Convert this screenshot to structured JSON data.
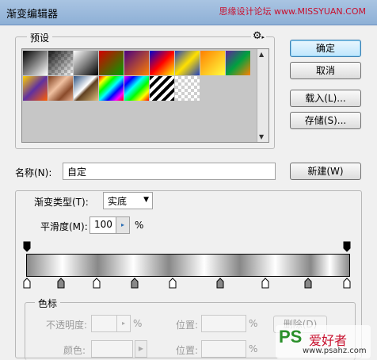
{
  "window": {
    "title": "渐变编辑器",
    "watermark": "思缘设计论坛 www.MISSYUAN.COM"
  },
  "buttons": {
    "ok": "确定",
    "cancel": "取消",
    "load": "载入(L)...",
    "save": "存储(S)...",
    "new": "新建(W)",
    "delete": "删除(D)"
  },
  "presets": {
    "legend": "预设",
    "swatches": [
      {
        "id": "black-white"
      },
      {
        "id": "transparent-fg"
      },
      {
        "id": "black-white-2"
      },
      {
        "id": "red-green"
      },
      {
        "id": "violet-orange"
      },
      {
        "id": "blue-red-yellow"
      },
      {
        "id": "blue-yellow-blue"
      },
      {
        "id": "orange-yellow"
      },
      {
        "id": "violet-green-orange"
      },
      {
        "id": "yellow-violet-orange"
      },
      {
        "id": "copper"
      },
      {
        "id": "chrome"
      },
      {
        "id": "spectrum"
      },
      {
        "id": "rainbow"
      },
      {
        "id": "stripes"
      },
      {
        "id": "transparent-checker"
      }
    ]
  },
  "name": {
    "label": "名称(N):",
    "value": "自定"
  },
  "gradient_type": {
    "label": "渐变类型(T):",
    "value": "实底"
  },
  "smoothness": {
    "label": "平滑度(M):",
    "value": "100",
    "unit": "%"
  },
  "stops": {
    "legend": "色标",
    "opacity_label": "不透明度:",
    "opacity_unit": "%",
    "location_label": "位置:",
    "location_unit": "%",
    "color_label": "颜色:",
    "location_label_2": "位置:",
    "location_unit_2": "%"
  },
  "bottom_watermark": {
    "logo": "PS",
    "cn": "爱好者",
    "url": "www.psahz.com"
  },
  "icons": {
    "gear": "gear-icon",
    "dropdown": "chevron-down-icon",
    "stepper": "chevron-right-icon"
  },
  "colors": {
    "title_bg": "#9dbbe0",
    "accent": "#3c7fb1"
  }
}
